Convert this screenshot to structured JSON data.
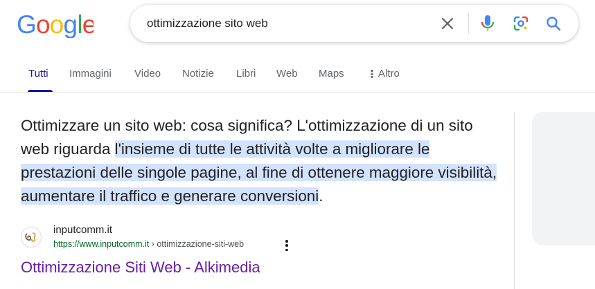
{
  "logo": {
    "text": "Google",
    "letter_colors": [
      "#4285F4",
      "#EA4335",
      "#FBBC05",
      "#4285F4",
      "#34A853",
      "#EA4335"
    ]
  },
  "search": {
    "query": "ottimizzazione sito web",
    "icons": [
      "close-icon",
      "microphone-icon",
      "lens-camera-icon",
      "search-icon"
    ]
  },
  "tabs": [
    {
      "label": "Tutti",
      "active": true
    },
    {
      "label": "Immagini"
    },
    {
      "label": "Video"
    },
    {
      "label": "Notizie"
    },
    {
      "label": "Libri"
    },
    {
      "label": "Web"
    },
    {
      "label": "Maps"
    },
    {
      "label": "Altro",
      "icon": "more-vertical-icon"
    }
  ],
  "snippet": {
    "plain": "Ottimizzare un sito web: cosa significa? L'ottimizzazione di un sito web riguarda ",
    "highlighted": "l'insieme di tutte le attività volte a migliorare le prestazioni delle singole pagine, al fine di ottenere maggiore visibilità, aumentare il traffico e generare conversioni",
    "end": "."
  },
  "source": {
    "site_name": "inputcomm.it",
    "url_domain": "https://www.inputcomm.it",
    "url_path": " › ottimizzazione-siti-web",
    "title": "Ottimizzazione Siti Web - Alkimedia"
  },
  "colors": {
    "accent_blue": "#1a0dab",
    "highlight": "#d3e3fd",
    "visited_link": "#681da8",
    "url_green": "#006621"
  }
}
